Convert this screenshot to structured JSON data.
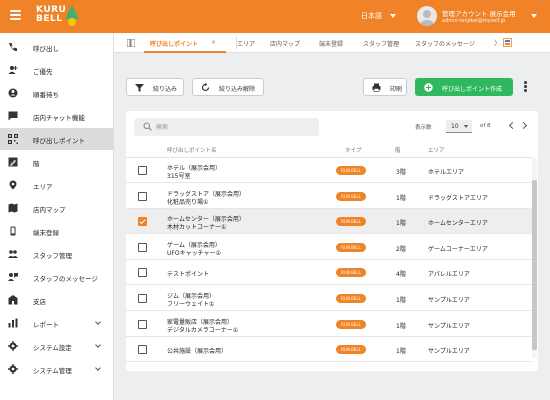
{
  "header": {
    "logo_text_1": "KURU",
    "logo_text_2": "BELL",
    "language": "日本語",
    "account_name": "管理アカウント 展示会用",
    "account_email": "admin-tenjikai@myself.jp",
    "brand_color": "#f08228"
  },
  "sidebar": {
    "items": [
      {
        "label": "呼び出し",
        "icon": "phone-icon"
      },
      {
        "label": "ご優先",
        "icon": "person-add-icon"
      },
      {
        "label": "順番待ち",
        "icon": "queue-icon"
      },
      {
        "label": "店内チャット機能",
        "icon": "chat-icon"
      },
      {
        "label": "呼び出しポイント",
        "icon": "qr-code-icon",
        "active": true
      },
      {
        "label": "階",
        "icon": "stairs-icon"
      },
      {
        "label": "エリア",
        "icon": "location-pin-icon"
      },
      {
        "label": "店内マップ",
        "icon": "map-icon"
      },
      {
        "label": "端末登録",
        "icon": "device-icon"
      },
      {
        "label": "スタッフ管理",
        "icon": "staff-icon"
      },
      {
        "label": "スタッフのメッセージ",
        "icon": "staff-message-icon"
      },
      {
        "label": "支店",
        "icon": "building-icon"
      },
      {
        "label": "レポート",
        "icon": "bar-chart-icon",
        "expandable": true
      },
      {
        "label": "システム設定",
        "icon": "settings-icon",
        "expandable": true
      },
      {
        "label": "システム管理",
        "icon": "admin-gear-icon",
        "expandable": true
      }
    ]
  },
  "tabs": {
    "items": [
      "呼び出しポイント",
      "エリア",
      "店内マップ",
      "端末登録",
      "スタッフ管理",
      "スタッフのメッセージ"
    ],
    "close": "×",
    "more": "〉"
  },
  "toolbar": {
    "filter_label": "絞り込み",
    "clear_filter_label": "絞り込み解除",
    "print_label": "印刷",
    "create_label": "呼び出しポイント作成"
  },
  "search": {
    "placeholder": "検索"
  },
  "pager": {
    "per_page_label": "表示数",
    "per_page_value": "10",
    "range": "of 8"
  },
  "table": {
    "headers": [
      "呼び出しポイント名",
      "タイプ",
      "階",
      "エリア"
    ],
    "rows": [
      {
        "name1": "ホテル（展示会用）",
        "name2": "315号室",
        "type": "RUN BELL",
        "floor": "3階",
        "area": "ホテルエリア",
        "checked": false
      },
      {
        "name1": "ドラッグストア（展示会用）",
        "name2": "化粧品売り場①",
        "type": "RUN BELL",
        "floor": "1階",
        "area": "ドラッグストアエリア",
        "checked": false
      },
      {
        "name1": "ホームセンター（展示会用）",
        "name2": "木材カットコーナー①",
        "type": "RUN BELL",
        "floor": "1階",
        "area": "ホームセンターエリア",
        "checked": true
      },
      {
        "name1": "ゲーム（展示会用）",
        "name2": "UFOキャッチャー①",
        "type": "RUN BELL",
        "floor": "2階",
        "area": "ゲームコーナーエリア",
        "checked": false
      },
      {
        "name1": "テストポイント",
        "name2": "",
        "type": "RUN BELL",
        "floor": "4階",
        "area": "アパレルエリア",
        "checked": false
      },
      {
        "name1": "ジム（展示会用）",
        "name2": "フリーウェイト①",
        "type": "RUN BELL",
        "floor": "1階",
        "area": "サンプルエリア",
        "checked": false
      },
      {
        "name1": "家電量販店（展示会用）",
        "name2": "デジタルカメラコーナー①",
        "type": "RUN BELL",
        "floor": "1階",
        "area": "サンプルエリア",
        "checked": false
      },
      {
        "name1": "公共施設（展示会用）",
        "name2": "",
        "type": "RUN BELL",
        "floor": "1階",
        "area": "サンプルエリア",
        "checked": false
      }
    ]
  }
}
